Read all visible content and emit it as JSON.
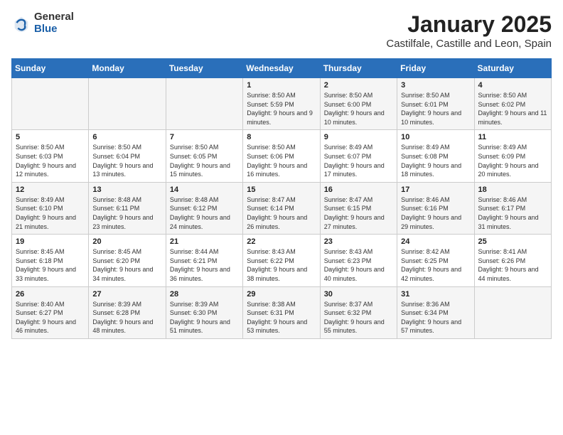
{
  "header": {
    "logo_general": "General",
    "logo_blue": "Blue",
    "month_title": "January 2025",
    "location": "Castilfale, Castille and Leon, Spain"
  },
  "weekdays": [
    "Sunday",
    "Monday",
    "Tuesday",
    "Wednesday",
    "Thursday",
    "Friday",
    "Saturday"
  ],
  "weeks": [
    [
      {
        "day": "",
        "info": ""
      },
      {
        "day": "",
        "info": ""
      },
      {
        "day": "",
        "info": ""
      },
      {
        "day": "1",
        "info": "Sunrise: 8:50 AM\nSunset: 5:59 PM\nDaylight: 9 hours and 9 minutes."
      },
      {
        "day": "2",
        "info": "Sunrise: 8:50 AM\nSunset: 6:00 PM\nDaylight: 9 hours and 10 minutes."
      },
      {
        "day": "3",
        "info": "Sunrise: 8:50 AM\nSunset: 6:01 PM\nDaylight: 9 hours and 10 minutes."
      },
      {
        "day": "4",
        "info": "Sunrise: 8:50 AM\nSunset: 6:02 PM\nDaylight: 9 hours and 11 minutes."
      }
    ],
    [
      {
        "day": "5",
        "info": "Sunrise: 8:50 AM\nSunset: 6:03 PM\nDaylight: 9 hours and 12 minutes."
      },
      {
        "day": "6",
        "info": "Sunrise: 8:50 AM\nSunset: 6:04 PM\nDaylight: 9 hours and 13 minutes."
      },
      {
        "day": "7",
        "info": "Sunrise: 8:50 AM\nSunset: 6:05 PM\nDaylight: 9 hours and 15 minutes."
      },
      {
        "day": "8",
        "info": "Sunrise: 8:50 AM\nSunset: 6:06 PM\nDaylight: 9 hours and 16 minutes."
      },
      {
        "day": "9",
        "info": "Sunrise: 8:49 AM\nSunset: 6:07 PM\nDaylight: 9 hours and 17 minutes."
      },
      {
        "day": "10",
        "info": "Sunrise: 8:49 AM\nSunset: 6:08 PM\nDaylight: 9 hours and 18 minutes."
      },
      {
        "day": "11",
        "info": "Sunrise: 8:49 AM\nSunset: 6:09 PM\nDaylight: 9 hours and 20 minutes."
      }
    ],
    [
      {
        "day": "12",
        "info": "Sunrise: 8:49 AM\nSunset: 6:10 PM\nDaylight: 9 hours and 21 minutes."
      },
      {
        "day": "13",
        "info": "Sunrise: 8:48 AM\nSunset: 6:11 PM\nDaylight: 9 hours and 23 minutes."
      },
      {
        "day": "14",
        "info": "Sunrise: 8:48 AM\nSunset: 6:12 PM\nDaylight: 9 hours and 24 minutes."
      },
      {
        "day": "15",
        "info": "Sunrise: 8:47 AM\nSunset: 6:14 PM\nDaylight: 9 hours and 26 minutes."
      },
      {
        "day": "16",
        "info": "Sunrise: 8:47 AM\nSunset: 6:15 PM\nDaylight: 9 hours and 27 minutes."
      },
      {
        "day": "17",
        "info": "Sunrise: 8:46 AM\nSunset: 6:16 PM\nDaylight: 9 hours and 29 minutes."
      },
      {
        "day": "18",
        "info": "Sunrise: 8:46 AM\nSunset: 6:17 PM\nDaylight: 9 hours and 31 minutes."
      }
    ],
    [
      {
        "day": "19",
        "info": "Sunrise: 8:45 AM\nSunset: 6:18 PM\nDaylight: 9 hours and 33 minutes."
      },
      {
        "day": "20",
        "info": "Sunrise: 8:45 AM\nSunset: 6:20 PM\nDaylight: 9 hours and 34 minutes."
      },
      {
        "day": "21",
        "info": "Sunrise: 8:44 AM\nSunset: 6:21 PM\nDaylight: 9 hours and 36 minutes."
      },
      {
        "day": "22",
        "info": "Sunrise: 8:43 AM\nSunset: 6:22 PM\nDaylight: 9 hours and 38 minutes."
      },
      {
        "day": "23",
        "info": "Sunrise: 8:43 AM\nSunset: 6:23 PM\nDaylight: 9 hours and 40 minutes."
      },
      {
        "day": "24",
        "info": "Sunrise: 8:42 AM\nSunset: 6:25 PM\nDaylight: 9 hours and 42 minutes."
      },
      {
        "day": "25",
        "info": "Sunrise: 8:41 AM\nSunset: 6:26 PM\nDaylight: 9 hours and 44 minutes."
      }
    ],
    [
      {
        "day": "26",
        "info": "Sunrise: 8:40 AM\nSunset: 6:27 PM\nDaylight: 9 hours and 46 minutes."
      },
      {
        "day": "27",
        "info": "Sunrise: 8:39 AM\nSunset: 6:28 PM\nDaylight: 9 hours and 48 minutes."
      },
      {
        "day": "28",
        "info": "Sunrise: 8:39 AM\nSunset: 6:30 PM\nDaylight: 9 hours and 51 minutes."
      },
      {
        "day": "29",
        "info": "Sunrise: 8:38 AM\nSunset: 6:31 PM\nDaylight: 9 hours and 53 minutes."
      },
      {
        "day": "30",
        "info": "Sunrise: 8:37 AM\nSunset: 6:32 PM\nDaylight: 9 hours and 55 minutes."
      },
      {
        "day": "31",
        "info": "Sunrise: 8:36 AM\nSunset: 6:34 PM\nDaylight: 9 hours and 57 minutes."
      },
      {
        "day": "",
        "info": ""
      }
    ]
  ]
}
